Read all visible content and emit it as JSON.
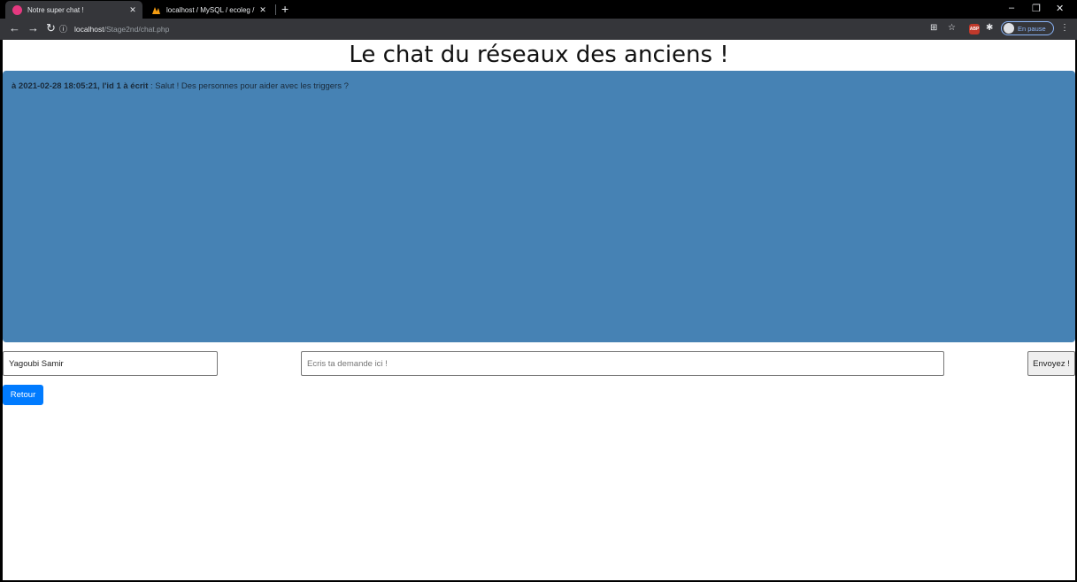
{
  "browser": {
    "tabs": [
      {
        "title": "Notre super chat !",
        "active": true
      },
      {
        "title": "localhost / MySQL / ecoleg / me",
        "active": false
      }
    ],
    "new_tab": "+",
    "address": {
      "host": "localhost",
      "path": "/Stage2nd/chat.php"
    },
    "profile_label": "En pause",
    "abp_label": "ABP"
  },
  "page": {
    "heading": "Le chat du réseaux des anciens !",
    "messages": [
      {
        "meta": "à 2021-02-28 18:05:21, l'id 1 à écrit",
        "separator": " : ",
        "text": "Salut ! Des personnes pour aider avec les triggers ?"
      }
    ],
    "name_value": "Yagoubi Samir",
    "message_placeholder": "Ecris ta demande ici !",
    "send_label": "Envoyez !",
    "back_label": "Retour"
  },
  "colors": {
    "chat_bg": "#4682b4",
    "back_button": "#007bff"
  }
}
